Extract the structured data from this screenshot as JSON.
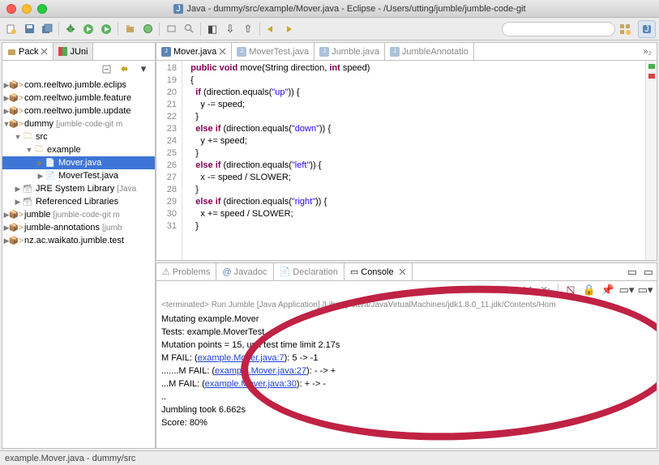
{
  "window": {
    "title": "Java - dummy/src/example/Mover.java - Eclipse - /Users/utting/jumble/jumble-code-git"
  },
  "sidebar": {
    "tabs": [
      "Pack",
      "JUni"
    ],
    "items": [
      {
        "label": "com.reeltwo.jumble.eclips"
      },
      {
        "label": "com.reeltwo.jumble.feature"
      },
      {
        "label": "com.reeltwo.jumble.update"
      },
      {
        "label": "dummy",
        "dec": "[jumble-code-git m"
      },
      {
        "label": "src"
      },
      {
        "label": "example"
      },
      {
        "label": "Mover.java"
      },
      {
        "label": "MoverTest.java"
      },
      {
        "label": "JRE System Library",
        "dec": "[Java"
      },
      {
        "label": "Referenced Libraries"
      },
      {
        "label": "jumble",
        "dec": "[jumble-code-git m"
      },
      {
        "label": "jumble-annotations",
        "dec": "[jumb"
      },
      {
        "label": "nz.ac.waikato.jumble.test"
      }
    ]
  },
  "editorTabs": [
    "Mover.java",
    "MoverTest.java",
    "Jumble.java",
    "JumbleAnnotatio"
  ],
  "code": {
    "start": 18,
    "lines": [
      {
        "n": 18,
        "t": "  public void move(String direction, int speed)"
      },
      {
        "n": 19,
        "t": "  {"
      },
      {
        "n": 20,
        "t": "    if (direction.equals(\"up\")) {"
      },
      {
        "n": 21,
        "t": "      y -= speed;"
      },
      {
        "n": 22,
        "t": "    }"
      },
      {
        "n": 23,
        "t": "    else if (direction.equals(\"down\")) {"
      },
      {
        "n": 24,
        "t": "      y += speed;"
      },
      {
        "n": 25,
        "t": "    }"
      },
      {
        "n": 26,
        "t": "    else if (direction.equals(\"left\")) {"
      },
      {
        "n": 27,
        "t": "      x -= speed / SLOWER;"
      },
      {
        "n": 28,
        "t": "    }"
      },
      {
        "n": 29,
        "t": "    else if (direction.equals(\"right\")) {"
      },
      {
        "n": 30,
        "t": "      x += speed / SLOWER;"
      },
      {
        "n": 31,
        "t": "    }"
      }
    ]
  },
  "bottomTabs": [
    "Problems",
    "Javadoc",
    "Declaration",
    "Console"
  ],
  "consoleHeader": "<terminated> Run Jumble [Java Application] /Library/Java/JavaVirtualMachines/jdk1.8.0_11.jdk/Contents/Hom",
  "console": {
    "pre1": "Mutating example.Mover\nTests: example.MoverTest\nMutation points = 15, unit test time limit 2.17s\nM FAIL: (",
    "link1": "example.Mover.java:7",
    "mid1": "): 5 -> -1\n.......M FAIL: (",
    "link2": "example.Mover.java:27",
    "mid2": "): - -> +\n...M FAIL: (",
    "link3": "example.Mover.java:30",
    "post": "): + -> -\n..\nJumbling took 6.662s\nScore: 80%"
  },
  "status": "example.Mover.java - dummy/src"
}
